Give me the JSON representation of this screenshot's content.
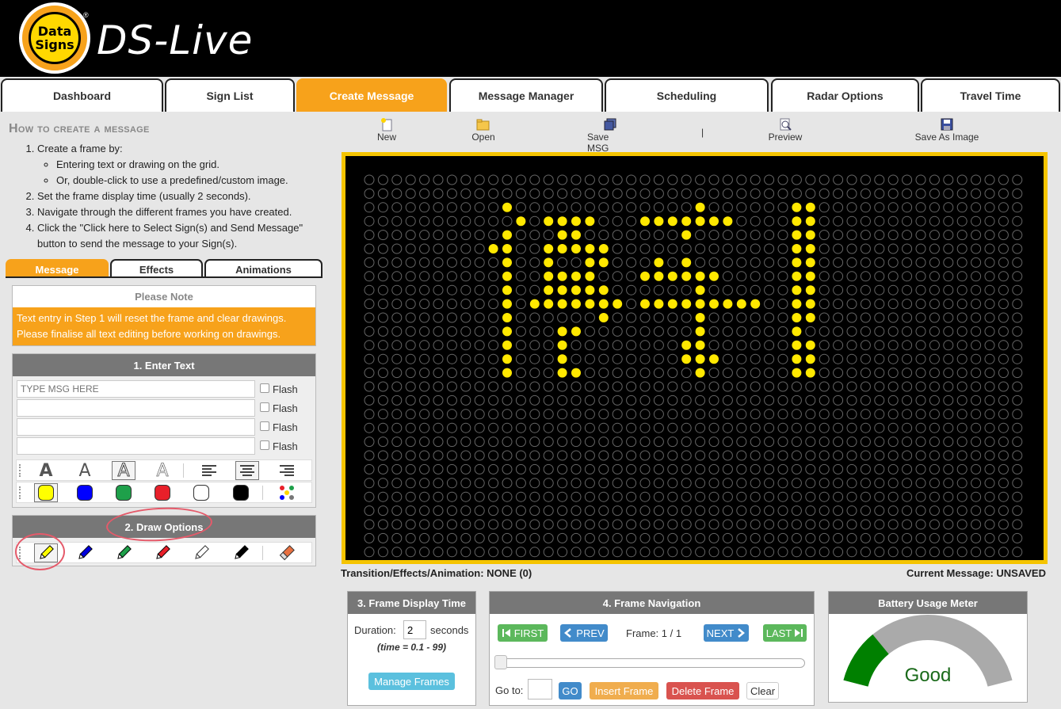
{
  "app": {
    "logo_line1": "Data",
    "logo_line2": "Signs",
    "reg": "®",
    "title": "DS-Live"
  },
  "tabs": [
    "Dashboard",
    "Sign List",
    "Create Message",
    "Message Manager",
    "Scheduling",
    "Radar Options",
    "Travel Time"
  ],
  "help": {
    "title": "How to create a message",
    "step1": "Create a frame by:",
    "step1a": "Entering text or drawing on the grid.",
    "step1b": "Or, double-click to use a predefined/custom image.",
    "step2": "Set the frame display time (usually 2 seconds).",
    "step3": "Navigate through the different frames you have created.",
    "step4": "Click the \"Click here to Select Sign(s) and Send Message\" button to send the message to your Sign(s)."
  },
  "left_tabs": [
    "Message",
    "Effects",
    "Animations"
  ],
  "note": {
    "title": "Please Note",
    "body": "Text entry in Step 1 will reset the frame and clear drawings. Please finalise all text editing before working on drawings."
  },
  "enter_text": {
    "title": "1. Enter Text",
    "placeholder": "TYPE MSG HERE",
    "flash": "Flash"
  },
  "font_styles": [
    "A",
    "A",
    "A",
    "A"
  ],
  "colors": {
    "yellow": "#ffff00",
    "blue": "#0000ff",
    "green": "#1ea04a",
    "red": "#e8202a",
    "white": "#ffffff",
    "black": "#000000"
  },
  "draw": {
    "title": "2. Draw Options"
  },
  "file_toolbar": [
    "New",
    "Open",
    "Save MSG",
    "Preview",
    "Save As Image"
  ],
  "file_toolbar_sep": "|",
  "sign": {
    "led_color": "#ffe800",
    "off_color": "#666666",
    "rows": 30,
    "cols": 48
  },
  "status": {
    "effects": "Transition/Effects/Animation: NONE (0)",
    "current": "Current Message: UNSAVED"
  },
  "frame_time": {
    "title": "3. Frame Display Time",
    "duration_label": "Duration:",
    "duration_value": "2",
    "unit": "seconds",
    "range": "(time = 0.1 - 99)",
    "manage": "Manage Frames"
  },
  "frame_nav": {
    "title": "4. Frame Navigation",
    "first": "FIRST",
    "prev": "PREV",
    "frame_label": "Frame: 1 / 1",
    "next": "NEXT",
    "last": "LAST",
    "goto_label": "Go to:",
    "go": "GO",
    "insert": "Insert Frame",
    "delete": "Delete Frame",
    "clear": "Clear"
  },
  "battery": {
    "title": "Battery Usage Meter",
    "label": "Good",
    "level": 0.12
  }
}
